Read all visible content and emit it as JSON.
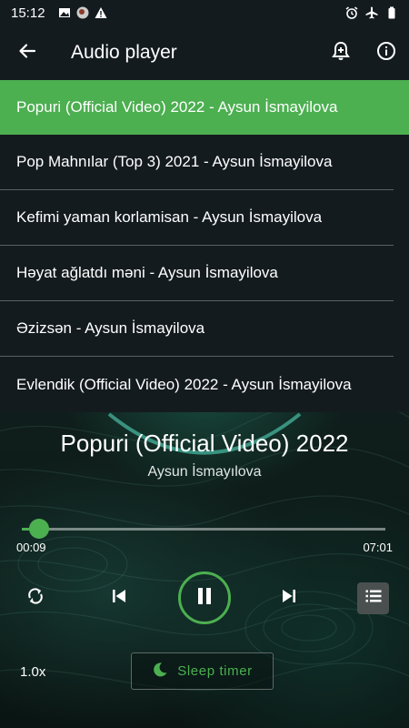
{
  "status_bar": {
    "time": "15:12",
    "left_icons": [
      "image-icon",
      "avatar-icon",
      "warning-icon"
    ],
    "right_icons": [
      "alarm-icon",
      "airplane-icon",
      "battery-icon"
    ]
  },
  "app_bar": {
    "title": "Audio player",
    "icons": [
      "back-arrow-icon",
      "alarm-add-icon",
      "info-icon"
    ]
  },
  "playlist": [
    {
      "label": "Popuri (Official Video) 2022 - Aysun İsmayilova",
      "active": true
    },
    {
      "label": "Pop Mahnılar (Top 3) 2021 - Aysun İsmayilova",
      "active": false
    },
    {
      "label": "Kefimi yaman korlamisan - Aysun İsmayilova",
      "active": false
    },
    {
      "label": "Həyat ağlatdı məni - Aysun İsmayilova",
      "active": false
    },
    {
      "label": "Əzizsən - Aysun İsmayilova",
      "active": false
    },
    {
      "label": "Evlendik (Official Video) 2022 - Aysun İsmayilova",
      "active": false
    }
  ],
  "now_playing": {
    "title": "Popuri (Official Video) 2022",
    "artist": "Aysun İsmayılova",
    "current_time": "00:09",
    "total_time": "07:01",
    "progress": 0.021
  },
  "controls": {
    "icons": [
      "repeat-icon",
      "previous-icon",
      "pause-icon",
      "next-icon",
      "queue-icon"
    ],
    "speed": "1.0x",
    "sleep_timer": "Sleep timer",
    "sleep_icon": "moon-icon"
  },
  "colors": {
    "accent": "#4caf50",
    "bar_bg": "#141b1f",
    "divider": "#5b6064"
  }
}
